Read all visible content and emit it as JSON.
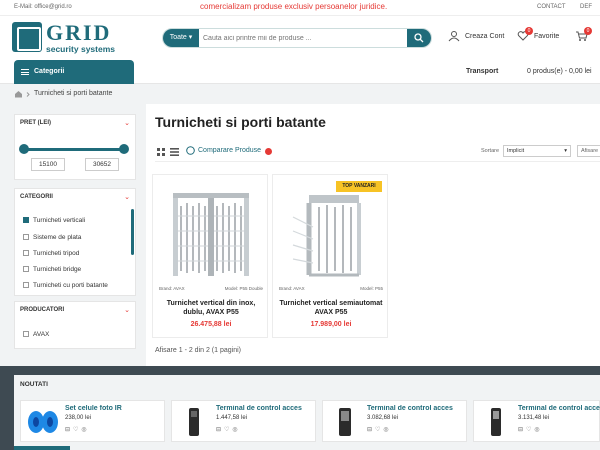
{
  "topbar": {
    "email": "E-Mail: office@grid.ro",
    "promo": "comercializam produse exclusiv persoanelor juridice.",
    "contact": "CONTACT",
    "other": "DEF"
  },
  "brand": {
    "name": "GRID",
    "tagline": "security systems",
    "color": "#1f6b7a"
  },
  "search": {
    "category": "Toate",
    "placeholder": "Cauta aici printre mii de produse ..."
  },
  "header": {
    "account": "Creaza Cont",
    "favorites": "Favorite",
    "favorites_count": "0",
    "cart_count": "0"
  },
  "nav": {
    "categories": "Categorii",
    "transport": "Transport",
    "cart_summary": "0 produs(e) - 0,00 lei"
  },
  "breadcrumb": {
    "current": "Turnicheti si porti batante"
  },
  "filters": {
    "price": {
      "title": "PRET (LEI)",
      "min": "15100",
      "max": "30652"
    },
    "categories": {
      "title": "CATEGORII",
      "items": [
        {
          "label": "Turnicheti verticali",
          "checked": true
        },
        {
          "label": "Sisteme de plata",
          "checked": false
        },
        {
          "label": "Turnicheti tripod",
          "checked": false
        },
        {
          "label": "Turnicheti bridge",
          "checked": false
        },
        {
          "label": "Turnicheti cu porti batante",
          "checked": false
        }
      ]
    },
    "producers": {
      "title": "PRODUCATORI",
      "items": [
        {
          "label": "AVAX",
          "checked": false
        }
      ]
    }
  },
  "main": {
    "title": "Turnicheti si porti batante",
    "compare": "Comparare Produse",
    "sort_label": "Sortare",
    "sort_value": "Implicit",
    "show_value": "Afisare",
    "pagination": "Afisare 1 - 2 din 2 (1 pagini)"
  },
  "products": [
    {
      "brand": "Brand: AVAX",
      "model": "Model: P55 Double",
      "name": "Turnichet vertical din inox, dublu, AVAX P55",
      "price": "26.475,88 lei",
      "tag": ""
    },
    {
      "brand": "Brand: AVAX",
      "model": "Model: P55",
      "name": "Turnichet vertical semiautomat AVAX P55",
      "price": "17.989,00 lei",
      "tag": "TOP VANZARI"
    }
  ],
  "news": {
    "title": "NOUTATI",
    "items": [
      {
        "name": "Set celule foto IR",
        "price": "238,00 lei",
        "icon": "photocell-icon"
      },
      {
        "name": "Terminal de control acces",
        "price": "1.447,58 lei",
        "icon": "terminal-icon"
      },
      {
        "name": "Terminal de control acces",
        "price": "3.082,68 lei",
        "icon": "terminal-icon"
      },
      {
        "name": "Terminal de control acces",
        "price": "3.131,48 lei",
        "icon": "terminal-icon"
      }
    ]
  }
}
